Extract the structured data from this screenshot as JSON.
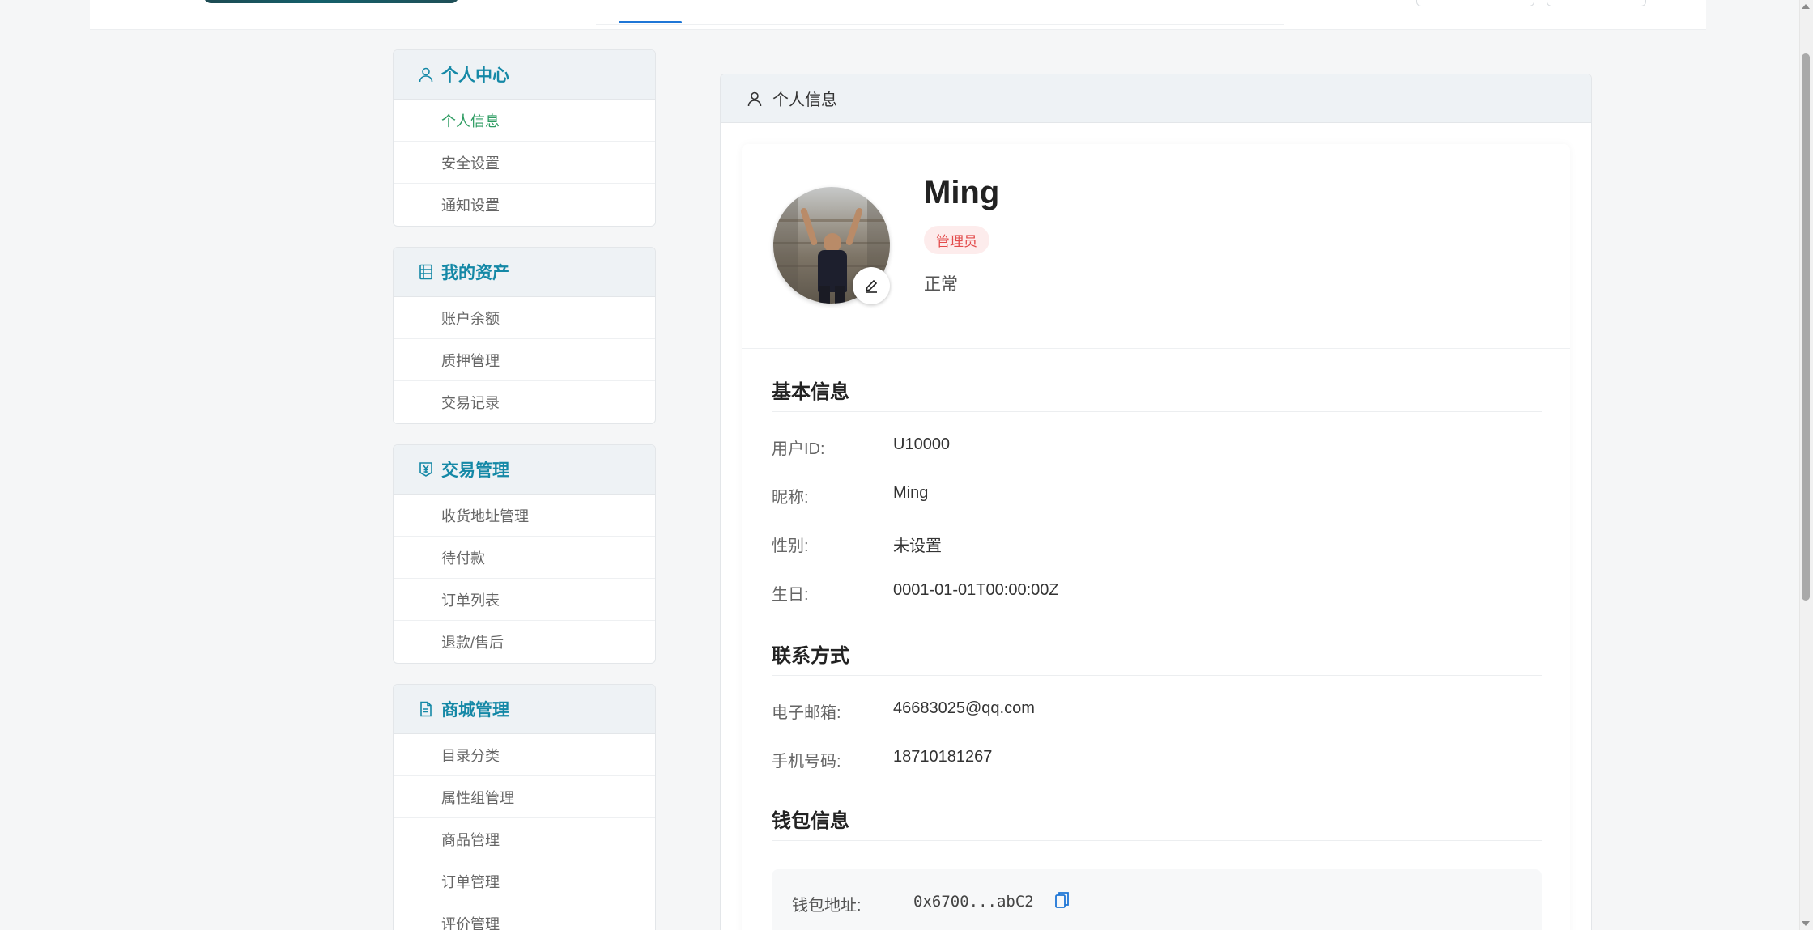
{
  "sidebar": {
    "groups": [
      {
        "title": "个人中心",
        "icon": "user-icon",
        "items": [
          "个人信息",
          "安全设置",
          "通知设置"
        ]
      },
      {
        "title": "我的资产",
        "icon": "ledger-icon",
        "items": [
          "账户余额",
          "质押管理",
          "交易记录"
        ]
      },
      {
        "title": "交易管理",
        "icon": "yen-tag-icon",
        "items": [
          "收货地址管理",
          "待付款",
          "订单列表",
          "退款/售后"
        ]
      },
      {
        "title": "商城管理",
        "icon": "document-icon",
        "items": [
          "目录分类",
          "属性组管理",
          "商品管理",
          "订单管理",
          "评价管理"
        ]
      }
    ],
    "active_item": "个人信息"
  },
  "main": {
    "header_title": "个人信息",
    "header_icon": "user-icon"
  },
  "profile": {
    "name": "Ming",
    "role_badge": "管理员",
    "status": "正常"
  },
  "basic_info": {
    "title": "基本信息",
    "fields": [
      {
        "label": "用户ID:",
        "value": "U10000"
      },
      {
        "label": "昵称:",
        "value": "Ming"
      },
      {
        "label": "性别:",
        "value": "未设置"
      },
      {
        "label": "生日:",
        "value": "0001-01-01T00:00:00Z"
      }
    ]
  },
  "contact": {
    "title": "联系方式",
    "fields": [
      {
        "label": "电子邮箱:",
        "value": "46683025@qq.com"
      },
      {
        "label": "手机号码:",
        "value": "18710181267"
      }
    ]
  },
  "wallet": {
    "title": "钱包信息",
    "label": "钱包地址:",
    "address": "0x6700...abC2",
    "copy_icon": "copy-icon"
  },
  "colors": {
    "accent": "#1488a6",
    "active_menu": "#2e9c62",
    "badge_text": "#e34c4c",
    "badge_bg": "#fdecec",
    "copy_icon": "#1e76d6"
  }
}
